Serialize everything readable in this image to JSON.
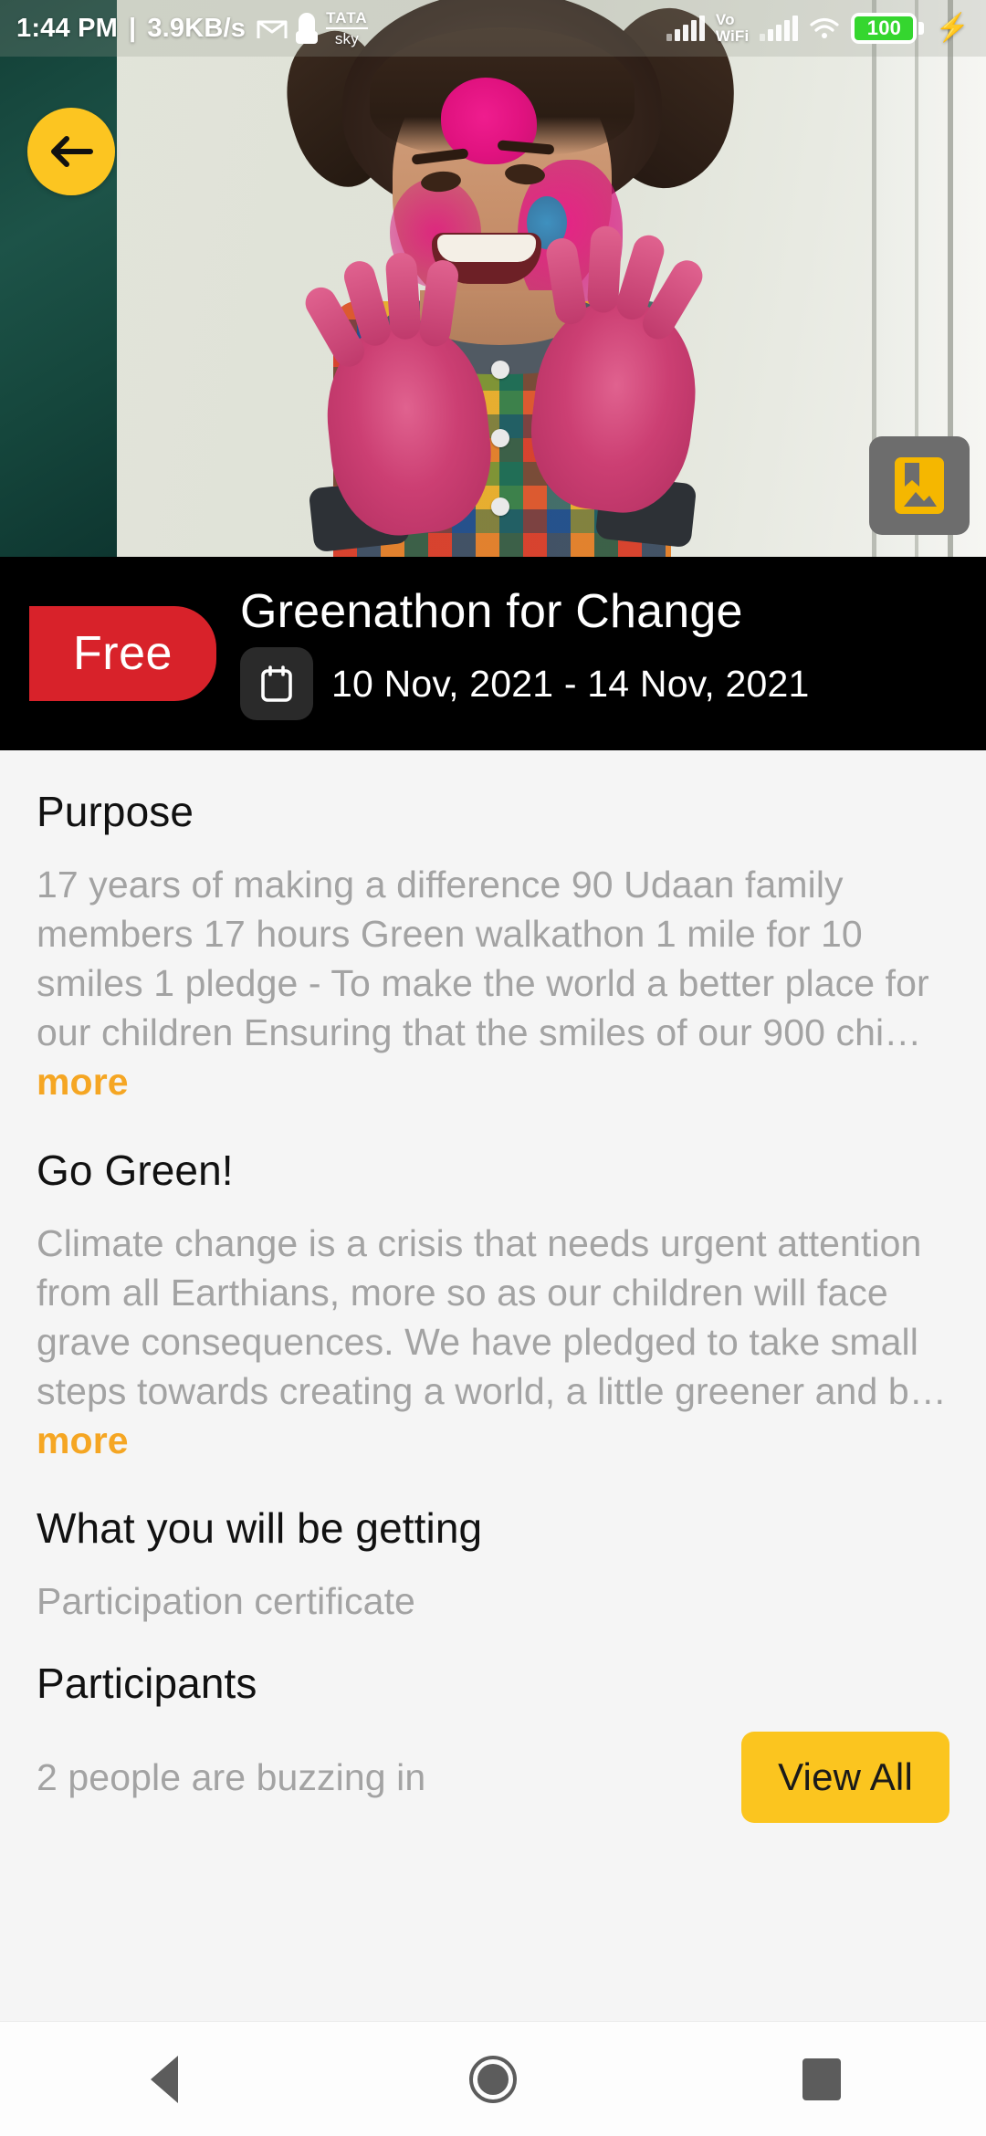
{
  "status_bar": {
    "time": "1:44 PM",
    "separator": "|",
    "network_speed": "3.9KB/s",
    "gmail_icon": "gmail-icon",
    "keyhole_icon": "keyhole-icon",
    "carrier_line1": "TATA",
    "carrier_line2": "sky",
    "volte_line1": "Vo",
    "volte_line2": "WiFi",
    "signal_icon": "signal-bars-icon",
    "wifi_icon": "wifi-icon",
    "battery_level": "100",
    "charging_icon": "charging-bolt-icon",
    "battery_color": "#35d62f"
  },
  "hero": {
    "back_button_icon": "arrow-left-icon",
    "back_button_color": "#fcc521",
    "gallery_badge_icon": "gallery-bookmark-icon",
    "gallery_badge_color": "#6d6d6d",
    "gallery_icon_color": "#f5b700",
    "alt": "Child with colored holi powder on face and hands"
  },
  "title_bar": {
    "price_badge": "Free",
    "price_badge_color": "#d8222a",
    "event_title": "Greenathon for Change",
    "calendar_icon": "calendar-icon",
    "date_range": "10 Nov, 2021 - 14 Nov, 2021",
    "background_color": "#000000"
  },
  "sections": [
    {
      "heading": "Purpose",
      "body": "17 years of making a difference 90 Udaan family members 17 hours Green walkathon 1 mile for 10 smiles 1 pledge - To make the world a better place for our children Ensuring that the smiles of our 900 chi…",
      "more_label": "more"
    },
    {
      "heading": "Go Green!",
      "body": "Climate change is a crisis that needs urgent attention from all Earthians, more so as our children will face grave consequences. We have pledged to take small steps towards creating a world, a little greener and b…",
      "more_label": "more"
    },
    {
      "heading": "What you will be getting",
      "body": "Participation certificate"
    },
    {
      "heading": "Participants",
      "body": "2 people are buzzing in",
      "action_label": "View All"
    }
  ],
  "colors": {
    "accent_yellow": "#fbc51f",
    "more_orange": "#f5a623",
    "body_gray": "#a3a3a3",
    "page_background": "#f5f5f5"
  },
  "navigation_bar": {
    "back_icon": "nav-back-triangle-icon",
    "home_icon": "nav-home-circle-icon",
    "recents_icon": "nav-recents-square-icon"
  }
}
